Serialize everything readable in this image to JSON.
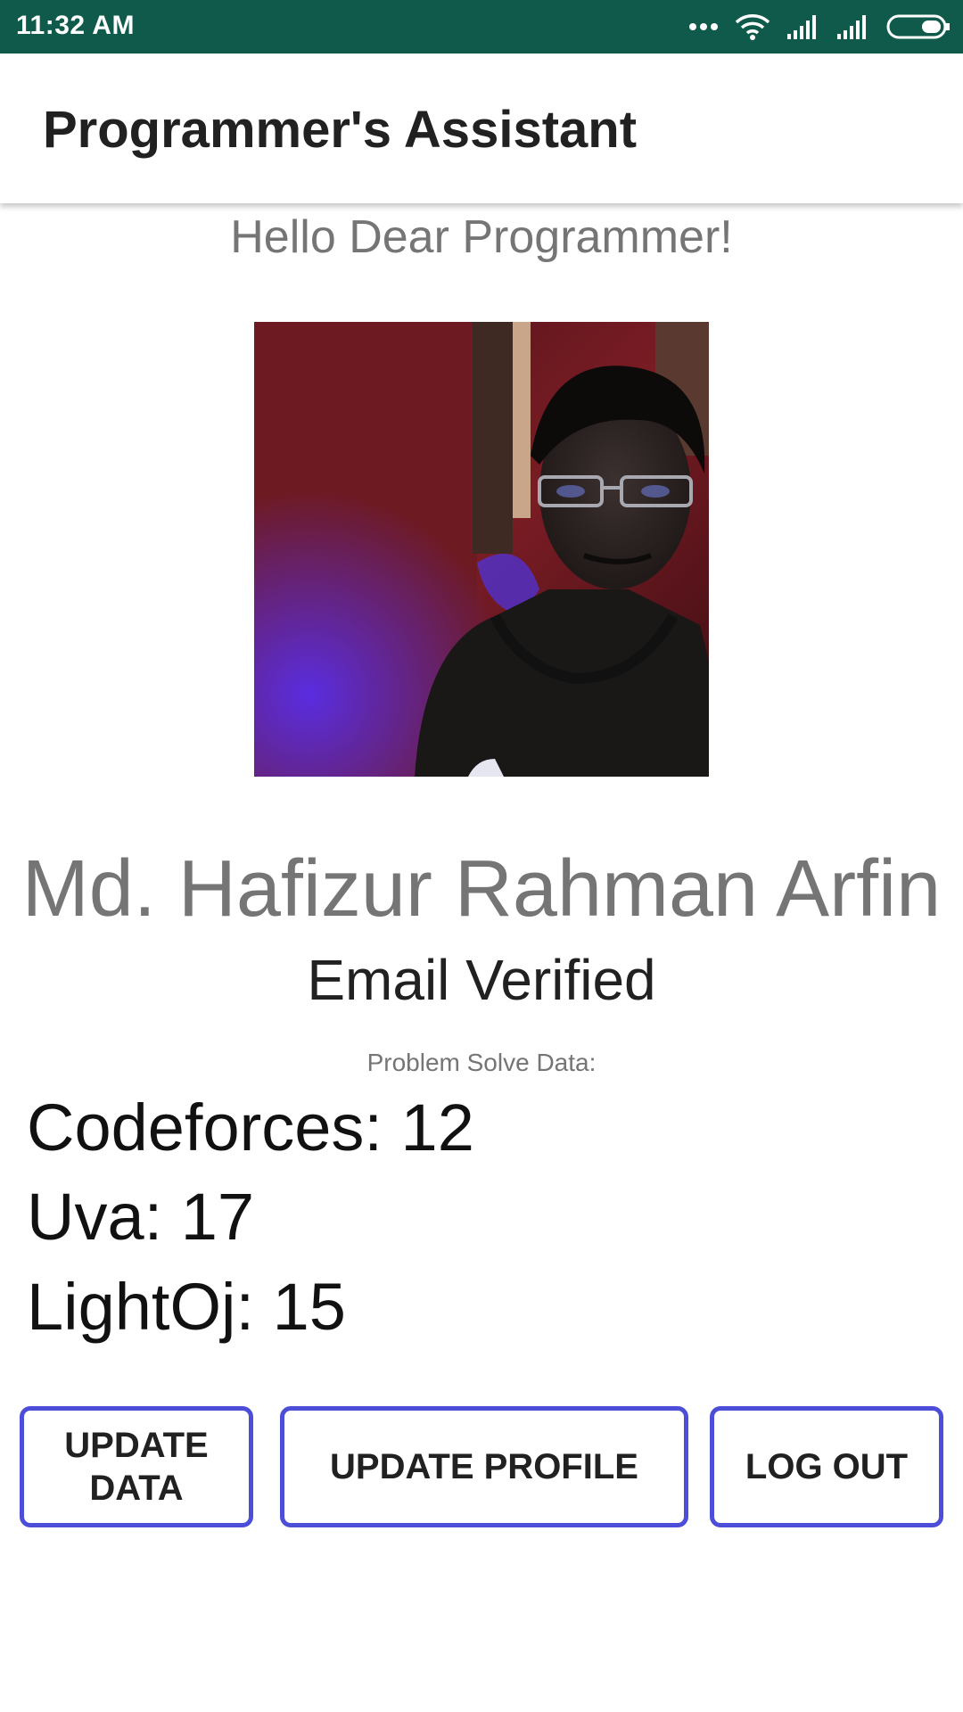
{
  "status_bar": {
    "time": "11:32 AM",
    "icons": [
      "more-dots-icon",
      "wifi-icon",
      "signal-icon",
      "signal-icon",
      "battery-icon"
    ],
    "background": "#0f5a4a"
  },
  "app_bar": {
    "title": "Programmer's Assistant"
  },
  "profile": {
    "greeting": "Hello Dear Programmer!",
    "name": "Md. Hafizur Rahman Arfin",
    "email_status": "Email Verified"
  },
  "problem_solve": {
    "heading": "Problem Solve Data:",
    "codeforces": "Codeforces: 12",
    "uva": "Uva: 17",
    "lightoj": "LightOj: 15"
  },
  "buttons": {
    "update_data": "UPDATE DATA",
    "update_profile": "UPDATE PROFILE",
    "log_out": "LOG OUT",
    "border_color": "#4c4ed8"
  }
}
